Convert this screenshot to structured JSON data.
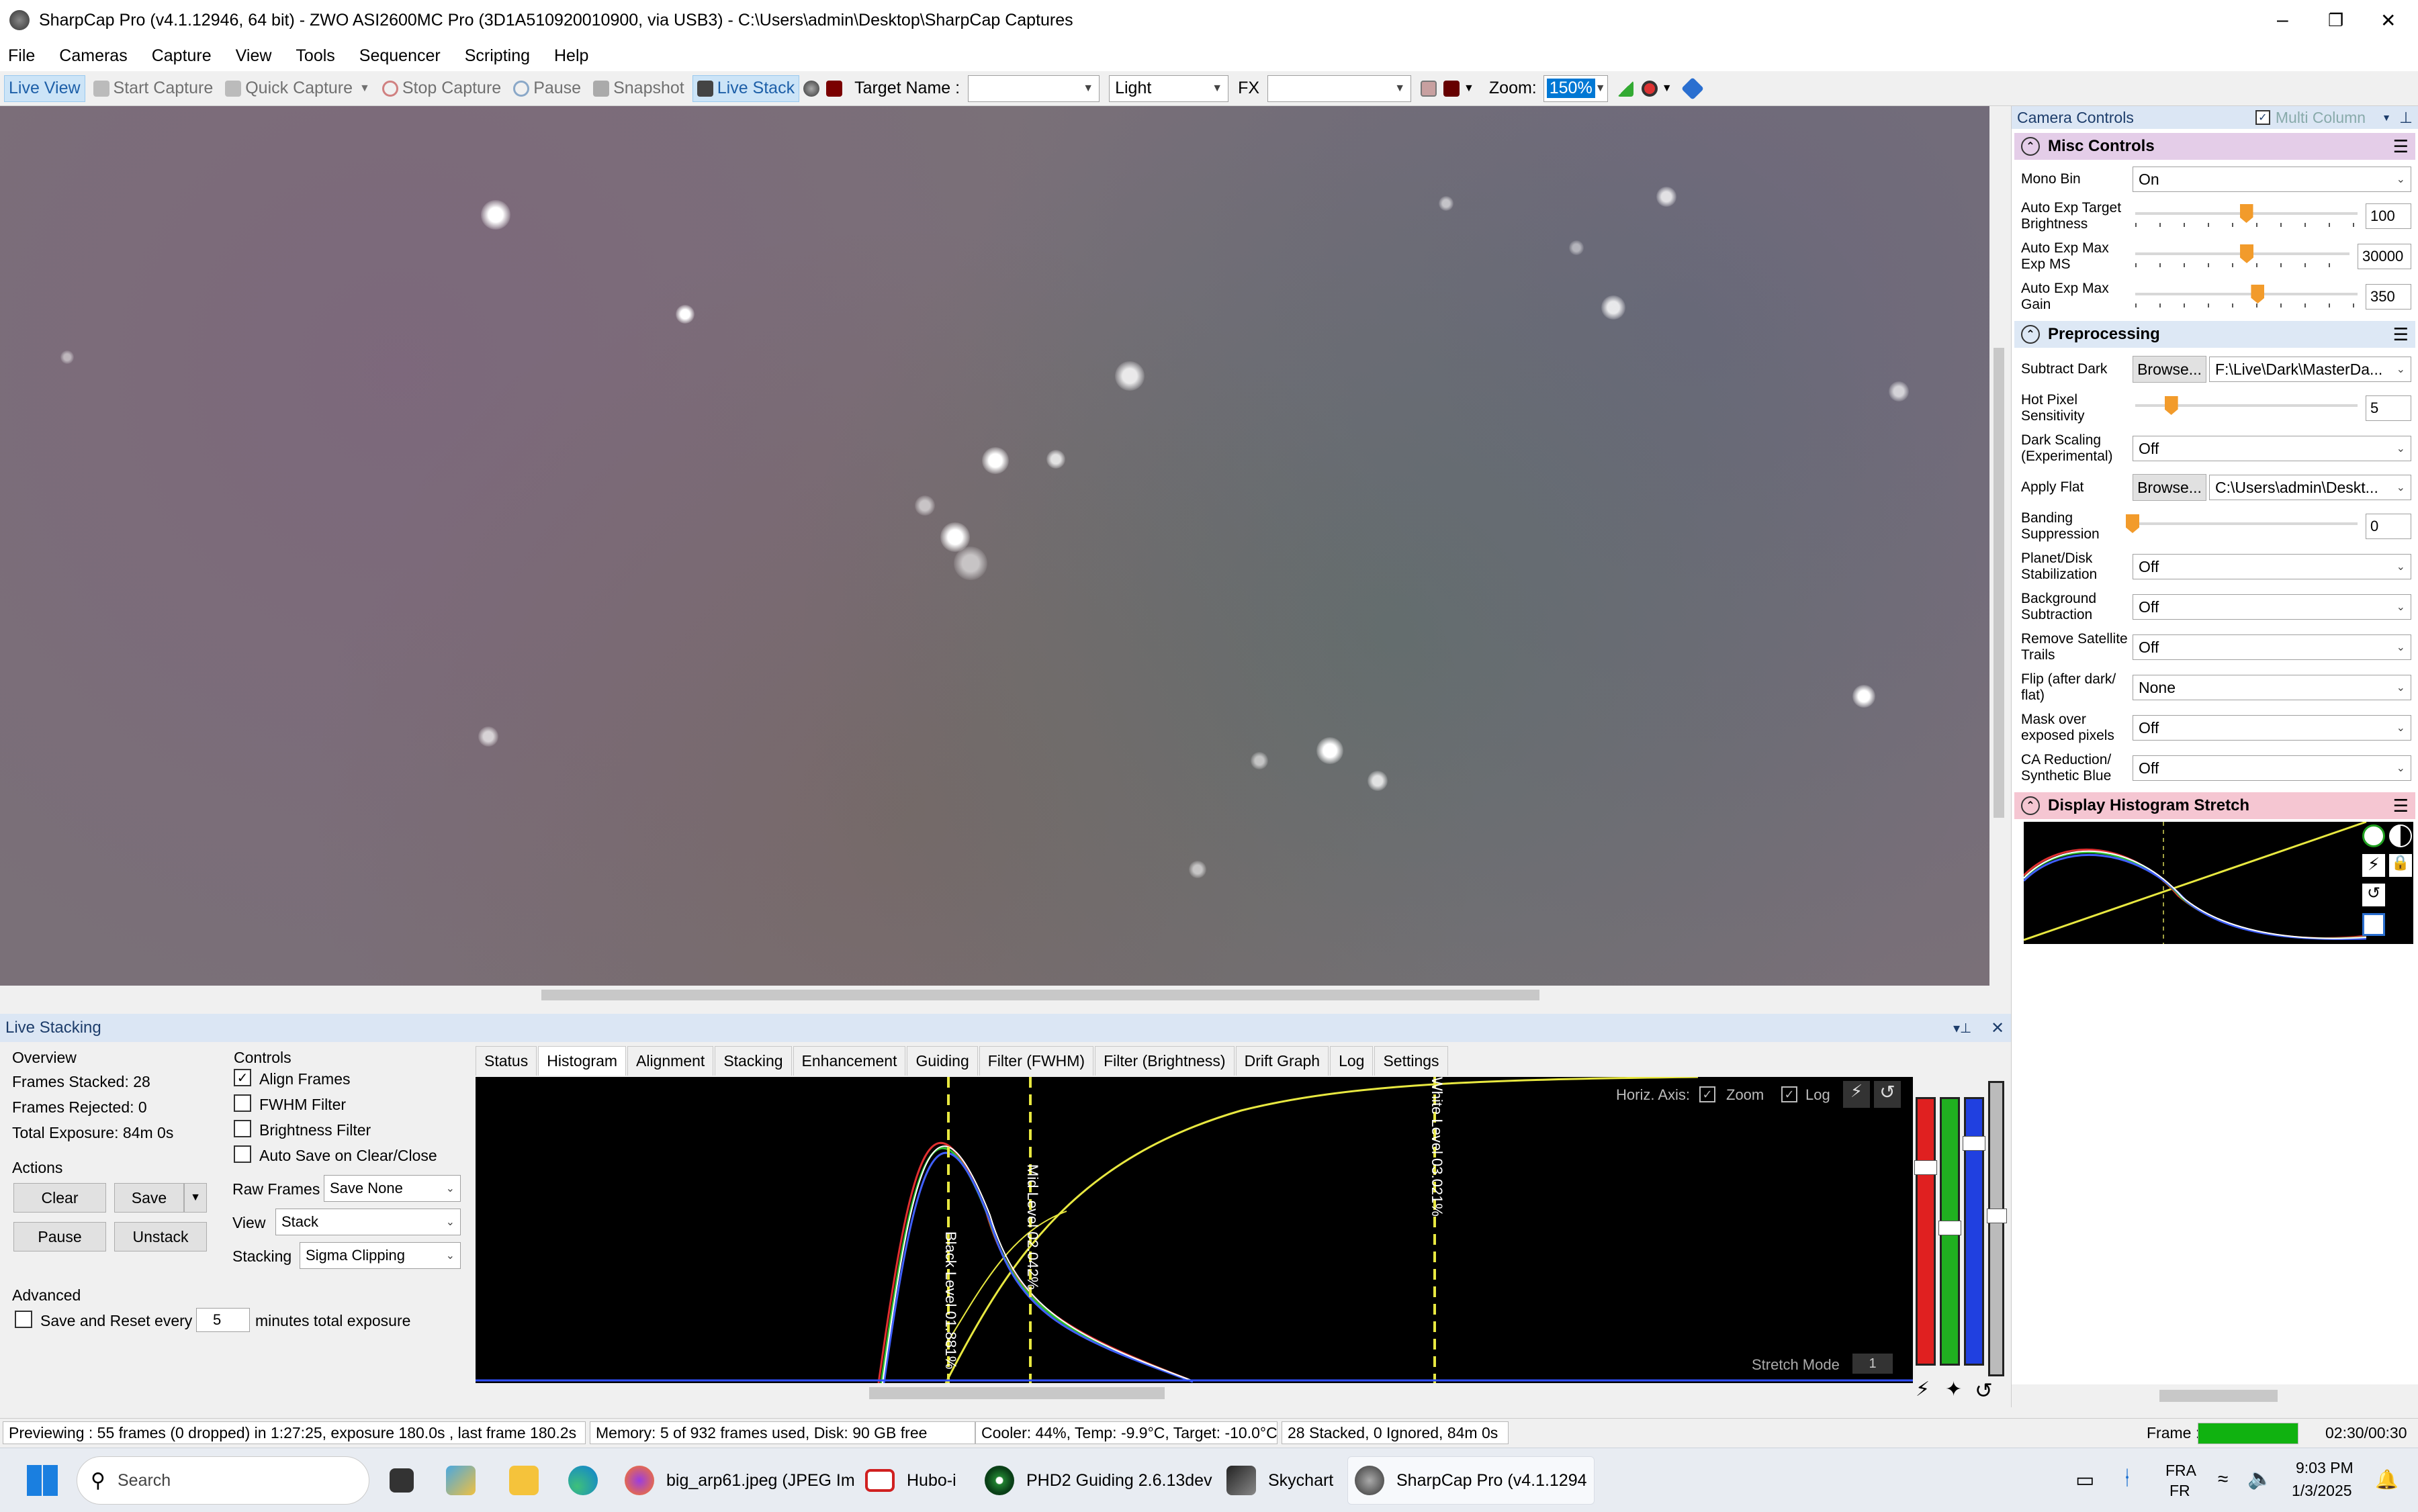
{
  "window": {
    "title": "SharpCap Pro (v4.1.12946, 64 bit) - ZWO ASI2600MC Pro (3D1A510920010900, via USB3) - C:\\Users\\admin\\Desktop\\SharpCap Captures"
  },
  "menu": [
    "File",
    "Cameras",
    "Capture",
    "View",
    "Tools",
    "Sequencer",
    "Scripting",
    "Help"
  ],
  "toolbar": {
    "live_view": "Live View",
    "start_capture": "Start Capture",
    "quick_capture": "Quick Capture",
    "stop_capture": "Stop Capture",
    "pause": "Pause",
    "snapshot": "Snapshot",
    "live_stack": "Live Stack",
    "target_label": "Target Name :",
    "target_value": "",
    "frame_type": "Light",
    "fx_label": "FX",
    "fx_value": "",
    "zoom_label": "Zoom:",
    "zoom_value": "150%"
  },
  "camera_controls": {
    "header": "Camera Controls",
    "multi_column": "Multi Column",
    "misc": {
      "title": "Misc Controls",
      "mono_bin_label": "Mono Bin",
      "mono_bin": "On",
      "auto_exp_target_label": "Auto Exp Target Brightness",
      "auto_exp_target": "100",
      "auto_exp_target_level": 0.5,
      "auto_exp_max_ms_label": "Auto Exp Max Exp MS",
      "auto_exp_max_ms": "30000",
      "auto_exp_max_ms_level": 0.52,
      "auto_exp_max_gain_label": "Auto Exp Max Gain",
      "auto_exp_max_gain": "350",
      "auto_exp_max_gain_level": 0.55
    },
    "pre": {
      "title": "Preprocessing",
      "subtract_dark_label": "Subtract Dark",
      "browse": "Browse...",
      "subtract_dark": "F:\\Live\\Dark\\MasterDa...",
      "hot_pixel_label": "Hot Pixel Sensitivity",
      "hot_pixel": "5",
      "hot_pixel_level": 0.17,
      "dark_scaling_label": "Dark Scaling (Experimental)",
      "dark_scaling": "Off",
      "apply_flat_label": "Apply Flat",
      "apply_flat": "C:\\Users\\admin\\Deskt...",
      "banding_label": "Banding Suppression",
      "banding": "0",
      "banding_level": 0,
      "planet_label": "Planet/Disk Stabilization",
      "planet": "Off",
      "background_label": "Background Subtraction",
      "background": "Off",
      "satellite_label": "Remove Satellite Trails",
      "satellite": "Off",
      "flip_label": "Flip (after dark/ flat)",
      "flip": "None",
      "mask_label": "Mask over exposed pixels",
      "mask": "Off",
      "ca_label": "CA Reduction/ Synthetic Blue",
      "ca": "Off"
    },
    "stretch": {
      "title": "Display Histogram Stretch"
    }
  },
  "live_stacking": {
    "title": "Live Stacking",
    "overview_label": "Overview",
    "frames_stacked": "Frames Stacked:  28",
    "frames_rejected": "Frames Rejected:  0",
    "total_exposure": "Total Exposure:   84m 0s",
    "actions_label": "Actions",
    "clear": "Clear",
    "save": "Save",
    "pause": "Pause",
    "unstack": "Unstack",
    "advanced_label": "Advanced",
    "save_reset_label": "Save and Reset every",
    "save_reset_value": "5",
    "minutes_label": "minutes total exposure",
    "controls_label": "Controls",
    "align_frames": "Align Frames",
    "fwhm_filter": "FWHM Filter",
    "brightness_filter": "Brightness Filter",
    "auto_save": "Auto Save on Clear/Close",
    "raw_frames_label": "Raw Frames",
    "raw_frames": "Save None",
    "view_label": "View",
    "view": "Stack",
    "stacking_label": "Stacking",
    "stacking": "Sigma Clipping",
    "tabs": [
      "Status",
      "Histogram",
      "Alignment",
      "Stacking",
      "Enhancement",
      "Guiding",
      "Filter (FWHM)",
      "Filter (Brightness)",
      "Drift Graph",
      "Log",
      "Settings"
    ],
    "histogram": {
      "horiz_axis": "Horiz. Axis:",
      "zoom": "Zoom",
      "log": "Log",
      "black_level": "Black Level  01.881%",
      "mid_level": "Mid Level  02.042%",
      "white_level": "White Level  03.021%",
      "stretch_mode": "Stretch Mode",
      "stretch_mode_value": "1"
    }
  },
  "status": {
    "previewing": "Previewing : 55 frames (0 dropped) in 1:27:25, exposure 180.0s , last frame 180.2s",
    "memory": "Memory: 5 of 932 frames used, Disk: 90 GB free",
    "cooler": "Cooler: 44%, Temp: -9.9°C, Target: -10.0°C",
    "stacked": "28 Stacked, 0 Ignored, 84m 0s",
    "frame_label": "Frame :",
    "frame_time": "02:30/00:30",
    "frame_progress": 1.0
  },
  "taskbar": {
    "search": "Search",
    "apps": [
      "big_arp61.jpeg (JPEG Im",
      "Hubo-i",
      "PHD2 Guiding 2.6.13dev",
      "Skychart",
      "SharpCap Pro (v4.1.1294"
    ],
    "lang1": "FRA",
    "lang2": "FR",
    "time": "9:03 PM",
    "date": "1/3/2025"
  },
  "colors": {
    "accent": "#0078d4",
    "slider_thumb": "#f29b2b",
    "misc_header": "#e4cde8",
    "pre_header": "#dde8f5",
    "stretch_header": "#f5c6d2",
    "progress": "#10b210"
  }
}
